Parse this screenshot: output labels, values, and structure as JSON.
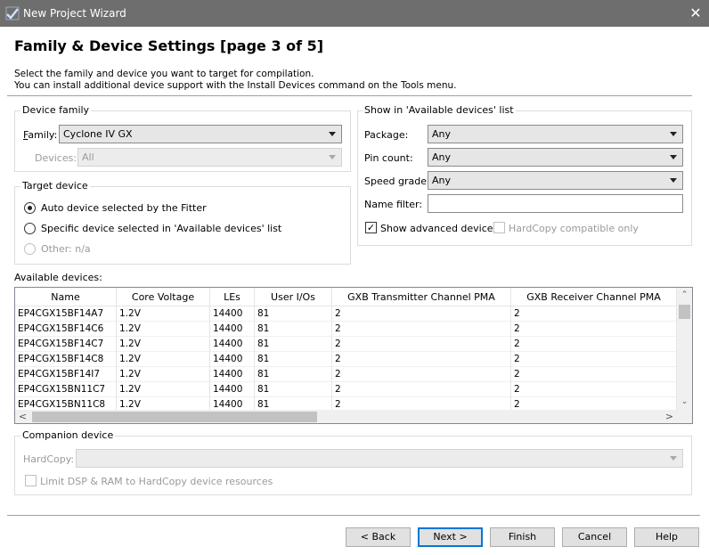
{
  "window": {
    "title": "New Project Wizard",
    "close_glyph": "✕",
    "icon": "wizard-app-icon"
  },
  "page": {
    "heading": "Family & Device Settings [page 3 of 5]",
    "desc_line1": "Select the family and device you want to target for compilation.",
    "desc_line2": "You can install additional device support with the Install Devices command on the Tools menu."
  },
  "device_family": {
    "group_label": "Device family",
    "family_label": "Family:",
    "family_value": "Cyclone IV GX",
    "devices_label": "Devices:",
    "devices_value": "All"
  },
  "target_device": {
    "group_label": "Target device",
    "options": [
      {
        "label": "Auto device selected by the Fitter",
        "checked": true,
        "enabled": true
      },
      {
        "label": "Specific device selected in 'Available devices' list",
        "checked": false,
        "enabled": true
      },
      {
        "label": "Other:  n/a",
        "checked": false,
        "enabled": false
      }
    ]
  },
  "show_in_list": {
    "group_label": "Show in 'Available devices' list",
    "package_label": "Package:",
    "package_value": "Any",
    "pin_count_label": "Pin count:",
    "pin_count_value": "Any",
    "speed_grade_label": "Speed grade:",
    "speed_grade_value": "Any",
    "name_filter_label": "Name filter:",
    "name_filter_value": "",
    "show_advanced_label": "Show advanced devices",
    "show_advanced_checked": true,
    "hardcopy_label": "HardCopy compatible only",
    "hardcopy_checked": false
  },
  "available_devices": {
    "label": "Available devices:",
    "columns": [
      "Name",
      "Core Voltage",
      "LEs",
      "User I/Os",
      "GXB Transmitter Channel PMA",
      "GXB Receiver Channel PMA"
    ],
    "rows": [
      [
        "EP4CGX15BF14A7",
        "1.2V",
        "14400",
        "81",
        "2",
        "2"
      ],
      [
        "EP4CGX15BF14C6",
        "1.2V",
        "14400",
        "81",
        "2",
        "2"
      ],
      [
        "EP4CGX15BF14C7",
        "1.2V",
        "14400",
        "81",
        "2",
        "2"
      ],
      [
        "EP4CGX15BF14C8",
        "1.2V",
        "14400",
        "81",
        "2",
        "2"
      ],
      [
        "EP4CGX15BF14I7",
        "1.2V",
        "14400",
        "81",
        "2",
        "2"
      ],
      [
        "EP4CGX15BN11C7",
        "1.2V",
        "14400",
        "81",
        "2",
        "2"
      ],
      [
        "EP4CGX15BN11C8",
        "1.2V",
        "14400",
        "81",
        "2",
        "2"
      ]
    ],
    "scroll_up": "⌃",
    "scroll_down": "⌄",
    "scroll_left": "<",
    "scroll_right": ">"
  },
  "companion": {
    "group_label": "Companion device",
    "hardcopy_label": "HardCopy:",
    "hardcopy_value": "",
    "limit_label": "Limit DSP & RAM to HardCopy device resources",
    "limit_checked": false
  },
  "buttons": {
    "back": "< Back",
    "next": "Next >",
    "finish": "Finish",
    "cancel": "Cancel",
    "help": "Help"
  },
  "colors": {
    "titlebar": "#6e6e6e",
    "default_button_border": "#0078d7"
  }
}
